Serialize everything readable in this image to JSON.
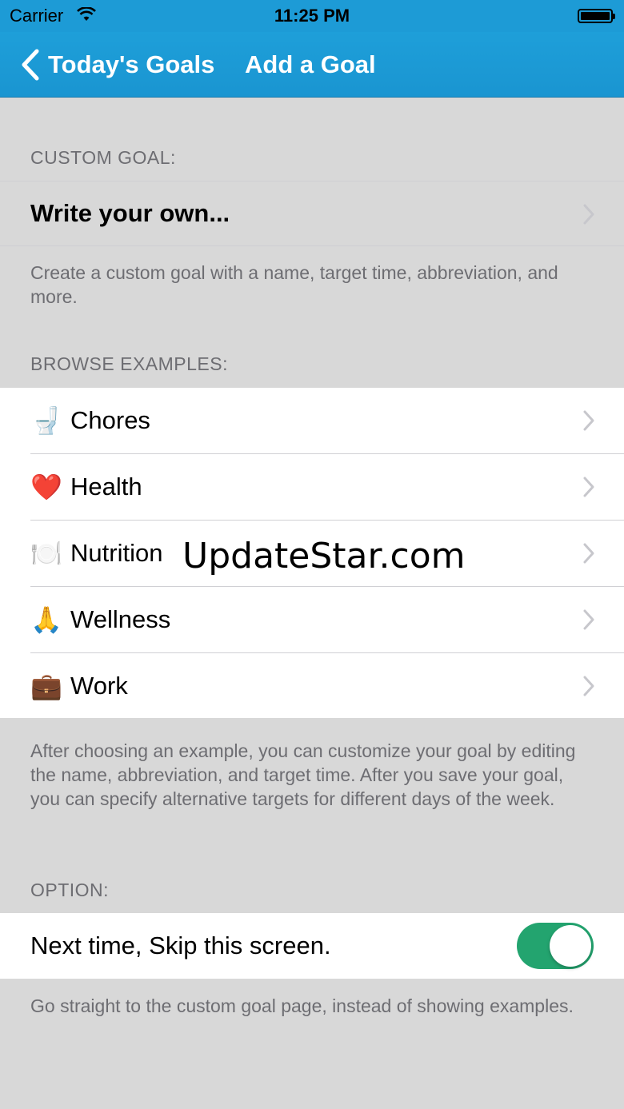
{
  "status_bar": {
    "carrier": "Carrier",
    "time": "11:25 PM"
  },
  "nav": {
    "back_label": "Today's Goals",
    "title": "Add a Goal"
  },
  "custom_goal": {
    "header": "CUSTOM GOAL:",
    "label": "Write your own...",
    "footer": "Create a custom goal with a name, target time, abbreviation, and more."
  },
  "browse": {
    "header": "BROWSE EXAMPLES:",
    "items": [
      {
        "emoji": "🚽",
        "label": "Chores"
      },
      {
        "emoji": "❤️",
        "label": "Health"
      },
      {
        "emoji": "🍽️",
        "label": "Nutrition"
      },
      {
        "emoji": "🙏",
        "label": "Wellness"
      },
      {
        "emoji": "💼",
        "label": "Work"
      }
    ],
    "footer": "After choosing an example, you can customize your goal by editing the name, abbreviation, and target time.  After you save your goal, you can specify alternative targets for different days of the week."
  },
  "watermark": "UpdateStar.com",
  "option": {
    "header": "OPTION:",
    "label": "Next time, Skip this screen.",
    "toggle_on": true,
    "footer": "Go straight to the custom goal page, instead of showing examples."
  },
  "colors": {
    "nav_bar": "#1e9fd9",
    "toggle_on": "#23a46f",
    "background": "#d8d8d8"
  }
}
